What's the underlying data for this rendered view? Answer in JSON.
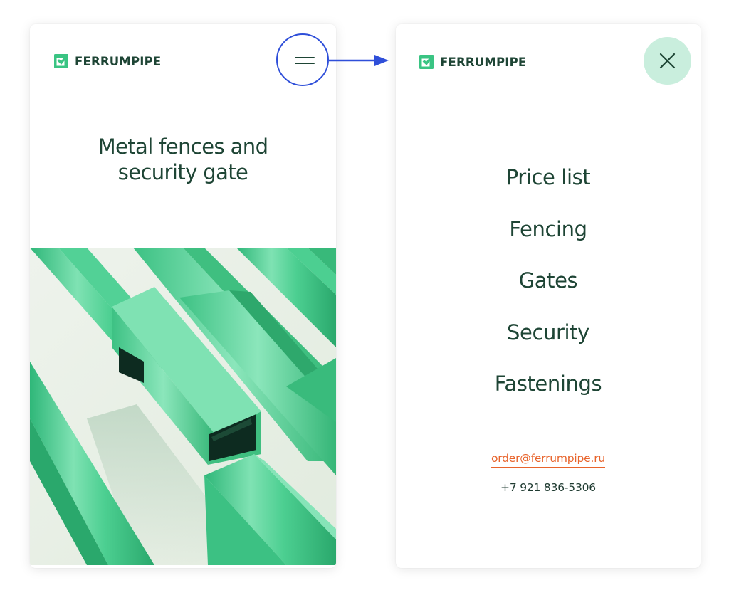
{
  "brand": {
    "name": "FERRUMPIPE",
    "logo_icon": "checkbox-logo-icon",
    "text_color": "#1e4535",
    "accent_color": "#3ac483"
  },
  "closed_view": {
    "menu_icon": "hamburger-icon",
    "hero_title_line1": "Metal fences and",
    "hero_title_line2": "security gate",
    "hero_image": "green-metal-pipes-photo"
  },
  "open_view": {
    "close_icon": "close-icon",
    "close_button_color": "#c9eedd",
    "menu_items": [
      {
        "label": "Price list"
      },
      {
        "label": "Fencing"
      },
      {
        "label": "Gates"
      },
      {
        "label": "Security"
      },
      {
        "label": "Fastenings"
      }
    ],
    "email": "order@ferrumpipe.ru",
    "phone": "+7 921 836-5306",
    "email_color": "#e8642c"
  },
  "annotation": {
    "highlight_color": "#2f4fd9"
  }
}
